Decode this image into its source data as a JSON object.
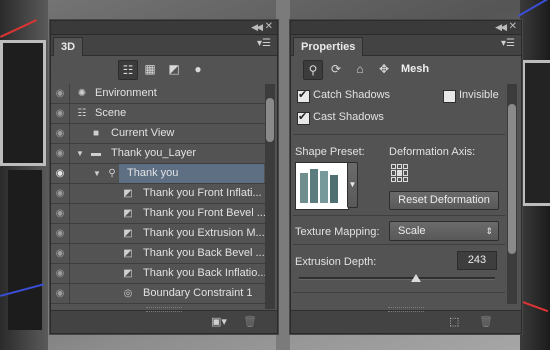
{
  "panel_3d": {
    "tab_label": "3D",
    "filter_icons": [
      "scene-filter-icon",
      "mesh-filter-icon",
      "material-filter-icon",
      "light-filter-icon"
    ],
    "rows": [
      {
        "label": "Environment",
        "icon": "environment-icon"
      },
      {
        "label": "Scene",
        "icon": "scene-icon"
      },
      {
        "label": "Current View",
        "icon": "camera-icon"
      },
      {
        "label": "Thank you_Layer",
        "icon": "folder-icon"
      },
      {
        "label": "Thank you",
        "icon": "mesh-icon"
      },
      {
        "label": "Thank you Front Inflati...",
        "icon": "material-icon"
      },
      {
        "label": "Thank you Front Bevel ...",
        "icon": "material-icon"
      },
      {
        "label": "Thank you Extrusion M...",
        "icon": "material-icon"
      },
      {
        "label": "Thank you Back Bevel ...",
        "icon": "material-icon"
      },
      {
        "label": "Thank you Back Inflatio...",
        "icon": "material-icon"
      },
      {
        "label": "Boundary Constraint 1",
        "icon": "constraint-icon"
      }
    ]
  },
  "panel_properties": {
    "tab_label": "Properties",
    "mode_label": "Mesh",
    "catch_shadows": {
      "label": "Catch Shadows",
      "checked": true
    },
    "invisible": {
      "label": "Invisible",
      "checked": false
    },
    "cast_shadows": {
      "label": "Cast Shadows",
      "checked": true
    },
    "shape_preset_label": "Shape Preset:",
    "deformation_axis_label": "Deformation Axis:",
    "reset_deformation_label": "Reset Deformation",
    "texture_mapping_label": "Texture Mapping:",
    "texture_mapping_value": "Scale",
    "extrusion_depth_label": "Extrusion Depth:",
    "extrusion_depth_value": "243"
  }
}
